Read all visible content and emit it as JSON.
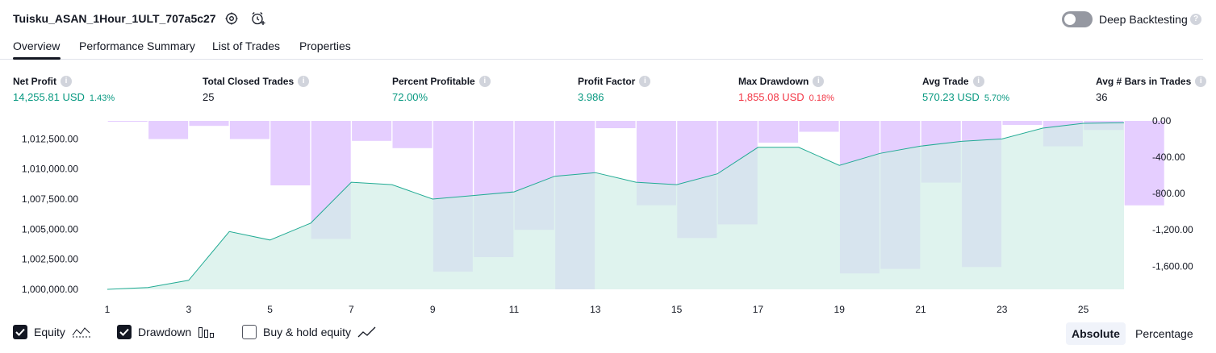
{
  "header": {
    "title": "Tuisku_ASAN_1Hour_1ULT_707a5c27",
    "deep_backtesting_label": "Deep Backtesting",
    "deep_backtesting_enabled": false
  },
  "tabs": [
    {
      "label": "Overview",
      "active": true
    },
    {
      "label": "Performance Summary",
      "active": false
    },
    {
      "label": "List of Trades",
      "active": false
    },
    {
      "label": "Properties",
      "active": false
    }
  ],
  "metrics": {
    "net_profit": {
      "label": "Net Profit",
      "value": "14,255.81 USD",
      "pct": "1.43%"
    },
    "total_closed_trades": {
      "label": "Total Closed Trades",
      "value": "25"
    },
    "percent_profitable": {
      "label": "Percent Profitable",
      "value": "72.00%"
    },
    "profit_factor": {
      "label": "Profit Factor",
      "value": "3.986"
    },
    "max_drawdown": {
      "label": "Max Drawdown",
      "value": "1,855.08 USD",
      "pct": "0.18%"
    },
    "avg_trade": {
      "label": "Avg Trade",
      "value": "570.23 USD",
      "pct": "5.70%"
    },
    "avg_bars": {
      "label": "Avg # Bars in Trades",
      "value": "36"
    }
  },
  "legend": {
    "equity": {
      "label": "Equity",
      "checked": true
    },
    "drawdown": {
      "label": "Drawdown",
      "checked": true
    },
    "buy_hold": {
      "label": "Buy & hold equity",
      "checked": false
    }
  },
  "view_toggle": {
    "absolute_label": "Absolute",
    "percentage_label": "Percentage",
    "selected": "Absolute"
  },
  "colors": {
    "equity_line": "#22ab94",
    "equity_fill": "#d2eee7",
    "drawdown_bar": "#e1c6ff",
    "positive": "#089981",
    "negative": "#f23645"
  },
  "chart_data": {
    "type": "line",
    "x_ticks": [
      "1",
      "3",
      "5",
      "7",
      "9",
      "11",
      "13",
      "15",
      "17",
      "19",
      "21",
      "23",
      "25"
    ],
    "x_range": [
      1,
      26
    ],
    "left_axis": {
      "ticks": [
        "1,000,000.00",
        "1,002,500.00",
        "1,005,000.00",
        "1,007,500.00",
        "1,010,000.00",
        "1,012,500.00"
      ],
      "range": [
        1000000,
        1014000
      ]
    },
    "right_axis": {
      "ticks": [
        "0.00",
        "-400.00",
        "-800.00",
        "-1,200.00",
        "-1,600.00"
      ],
      "range": [
        0,
        -1855.08
      ]
    },
    "series": [
      {
        "name": "Equity",
        "kind": "area",
        "x": [
          1,
          2,
          3,
          4,
          5,
          6,
          7,
          8,
          9,
          10,
          11,
          12,
          13,
          14,
          15,
          16,
          17,
          18,
          19,
          20,
          21,
          22,
          23,
          24,
          25,
          26
        ],
        "values": [
          1000000,
          1000150,
          1000750,
          1004800,
          1004100,
          1005500,
          1008900,
          1008700,
          1007500,
          1007800,
          1008100,
          1009400,
          1009700,
          1008900,
          1008700,
          1009600,
          1011800,
          1011800,
          1010300,
          1011300,
          1011900,
          1012300,
          1012500,
          1013400,
          1013800,
          1013850
        ]
      },
      {
        "name": "Drawdown",
        "kind": "bar",
        "x": [
          1,
          2,
          3,
          4,
          5,
          6,
          7,
          8,
          9,
          10,
          11,
          12,
          13,
          14,
          15,
          16,
          17,
          18,
          19,
          20,
          21,
          22,
          23,
          24,
          25,
          26
        ],
        "values": [
          -10,
          -200,
          -55,
          -200,
          -710,
          -1300,
          -220,
          -300,
          -1660,
          -1500,
          -1200,
          -1855.08,
          -80,
          -930,
          -1290,
          -1140,
          -240,
          -120,
          -1680,
          -1630,
          -680,
          -1610,
          -45,
          -280,
          -100,
          -930
        ]
      }
    ]
  }
}
